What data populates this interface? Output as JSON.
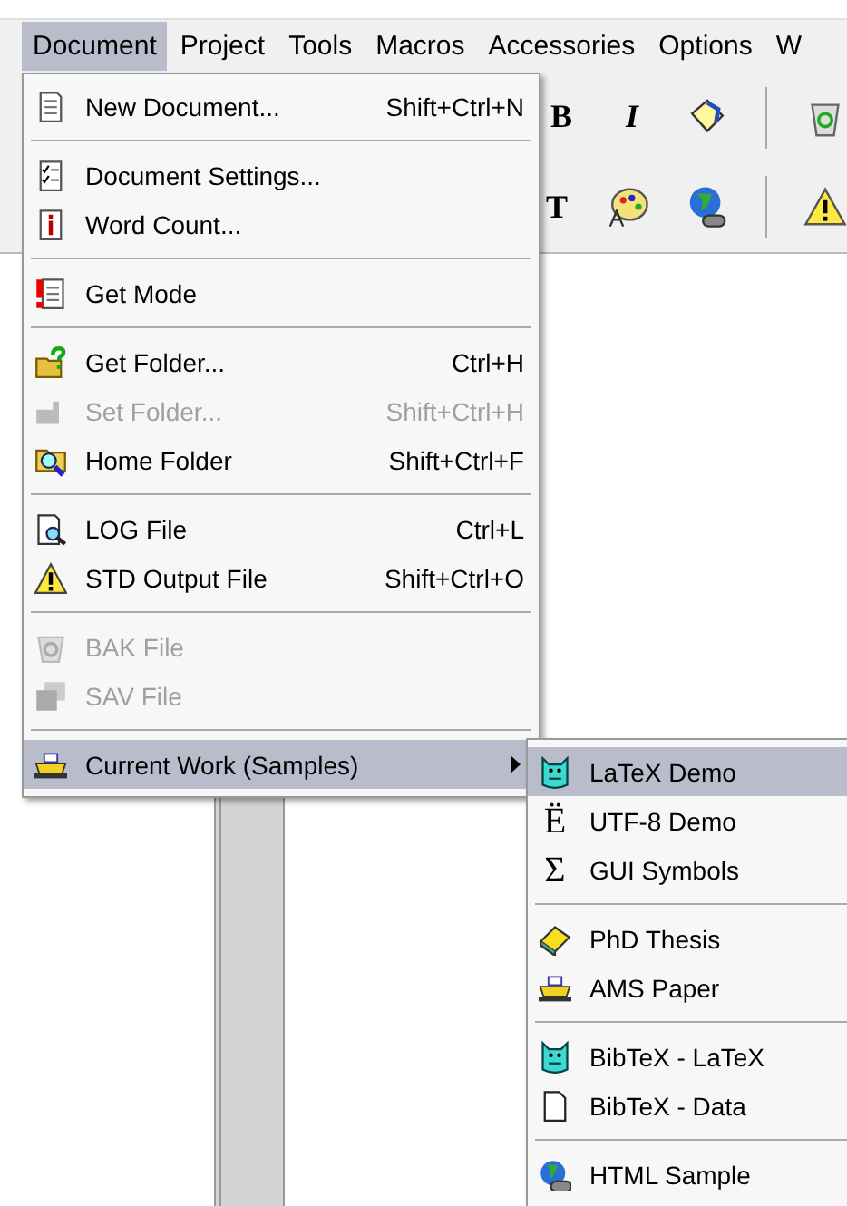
{
  "menubar": [
    {
      "label": "Document",
      "selected": true
    },
    {
      "label": "Project",
      "selected": false
    },
    {
      "label": "Tools",
      "selected": false
    },
    {
      "label": "Macros",
      "selected": false
    },
    {
      "label": "Accessories",
      "selected": false
    },
    {
      "label": "Options",
      "selected": false
    },
    {
      "label": "W",
      "selected": false
    }
  ],
  "toolbar": {
    "rows": [
      [
        "B",
        "I"
      ],
      [
        "T"
      ]
    ]
  },
  "menu": {
    "groups": [
      [
        {
          "label": "New Document...",
          "shortcut": "Shift+Ctrl+N",
          "disabled": false,
          "selected": false
        }
      ],
      [
        {
          "label": "Document Settings...",
          "disabled": false,
          "selected": false
        },
        {
          "label": "Word Count...",
          "disabled": false,
          "selected": false
        }
      ],
      [
        {
          "label": "Get Mode",
          "disabled": false,
          "selected": false
        }
      ],
      [
        {
          "label": "Get Folder...",
          "shortcut": "Ctrl+H",
          "disabled": false,
          "selected": false
        },
        {
          "label": "Set Folder...",
          "shortcut": "Shift+Ctrl+H",
          "disabled": true,
          "selected": false
        },
        {
          "label": "Home Folder",
          "shortcut": "Shift+Ctrl+F",
          "disabled": false,
          "selected": false
        }
      ],
      [
        {
          "label": "LOG File",
          "shortcut": "Ctrl+L",
          "disabled": false,
          "selected": false
        },
        {
          "label": "STD Output File",
          "shortcut": "Shift+Ctrl+O",
          "disabled": false,
          "selected": false
        }
      ],
      [
        {
          "label": "BAK File",
          "disabled": true,
          "selected": false
        },
        {
          "label": "SAV File",
          "disabled": true,
          "selected": false
        }
      ],
      [
        {
          "label": "Current Work (Samples)",
          "disabled": false,
          "selected": true,
          "submenu": true
        }
      ]
    ]
  },
  "submenu": {
    "groups": [
      [
        {
          "label": "LaTeX Demo",
          "selected": true
        },
        {
          "label": "UTF-8 Demo",
          "glyph": "Ë",
          "selected": false
        },
        {
          "label": "GUI Symbols",
          "glyph": "Σ",
          "selected": false
        }
      ],
      [
        {
          "label": "PhD Thesis",
          "selected": false
        },
        {
          "label": "AMS Paper",
          "selected": false
        }
      ],
      [
        {
          "label": "BibTeX - LaTeX",
          "selected": false
        },
        {
          "label": "BibTeX - Data",
          "selected": false
        }
      ],
      [
        {
          "label": "HTML Sample",
          "selected": false
        }
      ]
    ]
  }
}
